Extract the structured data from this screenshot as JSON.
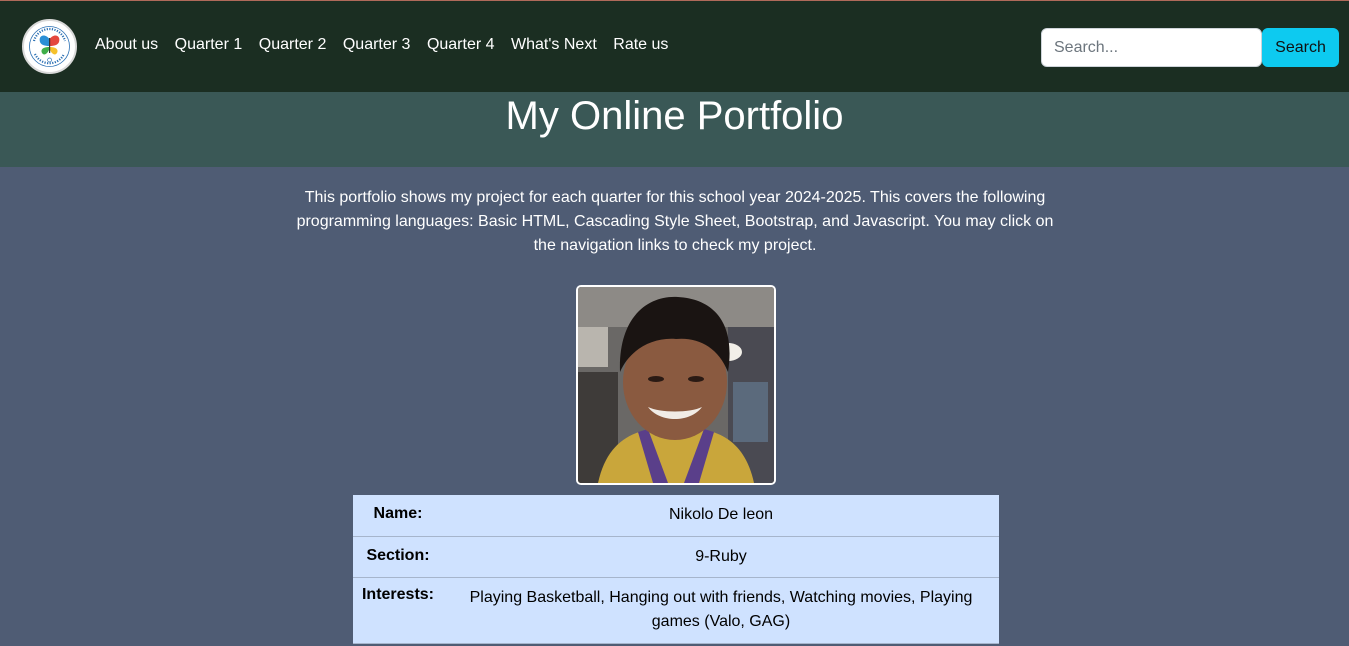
{
  "nav": {
    "logo_text": "I'M AN OBMC PEACE BUILDER",
    "links": [
      {
        "label": "About us"
      },
      {
        "label": "Quarter 1"
      },
      {
        "label": "Quarter 2"
      },
      {
        "label": "Quarter 3"
      },
      {
        "label": "Quarter 4"
      },
      {
        "label": "What's Next"
      },
      {
        "label": "Rate us"
      }
    ],
    "search": {
      "placeholder": "Search...",
      "value": "",
      "button_label": "Search"
    }
  },
  "hero": {
    "title": "My Online Portfolio"
  },
  "intro": "This portfolio shows my project for each quarter for this school year 2024-2025. This covers the following programming languages: Basic HTML, Cascading Style Sheet, Bootstrap, and Javascript. You may click on the navigation links to check my project.",
  "profile": {
    "rows": [
      {
        "label": "Name:",
        "value": "Nikolo De leon"
      },
      {
        "label": "Section:",
        "value": "9-Ruby"
      },
      {
        "label": "Interests:",
        "value": "Playing Basketball, Hanging out with friends, Watching movies, Playing games (Valo, GAG)"
      }
    ]
  },
  "colors": {
    "nav_bg": "#1b2e22",
    "hero_bg": "#3a5856",
    "page_bg": "#4f5c74",
    "table_bg": "#cfe2ff",
    "search_button": "#0dcaf0"
  }
}
